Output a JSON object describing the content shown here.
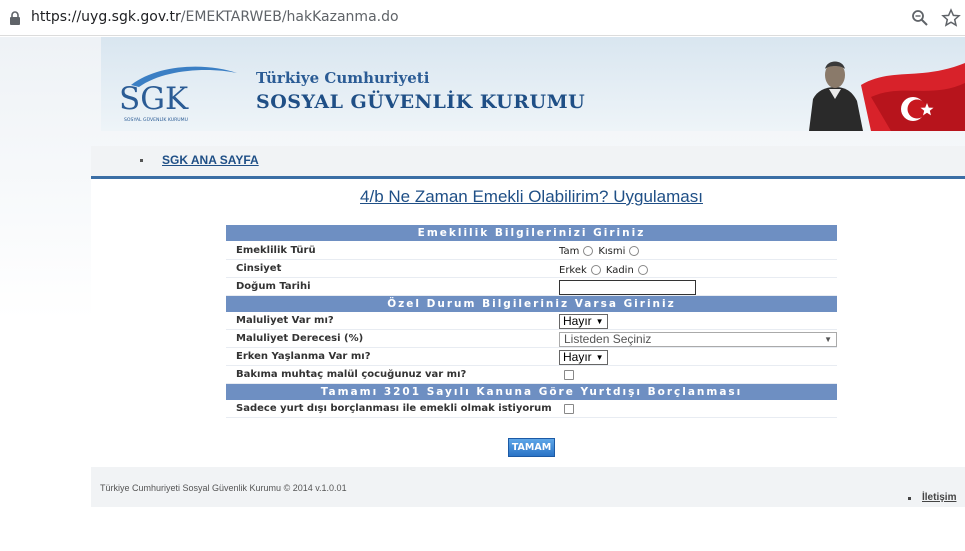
{
  "browser": {
    "url_host": "https://uyg.sgk.gov.tr",
    "url_path": "/EMEKTARWEB/hakKazanma.do"
  },
  "header": {
    "logo_text": "SGK",
    "logo_sub": "SOSYAL GÜVENLİK KURUMU",
    "line1": "Türkiye Cumhuriyeti",
    "line2": "SOSYAL GÜVENLİK KURUMU"
  },
  "nav": {
    "home_link": "SGK ANA SAYFA"
  },
  "page": {
    "title": "4/b Ne Zaman Emekli Olabilirim? Uygulaması"
  },
  "section1": {
    "heading": "Emeklilik Bilgilerinizi Giriniz",
    "retirement_type": {
      "label": "Emeklilik Türü",
      "opt1": "Tam",
      "opt2": "Kısmi"
    },
    "gender": {
      "label": "Cinsiyet",
      "opt1": "Erkek",
      "opt2": "Kadin"
    },
    "birth_date": {
      "label": "Doğum Tarihi",
      "value": ""
    }
  },
  "section2": {
    "heading": "Özel Durum Bilgileriniz Varsa Giriniz",
    "disability": {
      "label": "Maluliyet Var mı?",
      "value": "Hayır"
    },
    "disability_degree": {
      "label": "Maluliyet Derecesi (%)",
      "value": "Listeden Seçiniz"
    },
    "early_aging": {
      "label": "Erken Yaşlanma Var mı?",
      "value": "Hayır"
    },
    "dependent_child": {
      "label": "Bakıma muhtaç malül çocuğunuz var mı?"
    }
  },
  "section3": {
    "heading": "Tamamı 3201 Sayılı Kanuna Göre Yurtdışı Borçlanması",
    "abroad_only": {
      "label": "Sadece yurt dışı borçlanması ile emekli olmak istiyorum"
    }
  },
  "submit_label": "TAMAM",
  "footer": {
    "copyright": "Türkiye Cumhuriyeti Sosyal Güvenlik Kurumu © 2014 v.1.0.01",
    "contact": "İletişim"
  },
  "colors": {
    "accent": "#1f4f86",
    "section_bar": "#6e8fc2",
    "button": "#2a73c6"
  }
}
